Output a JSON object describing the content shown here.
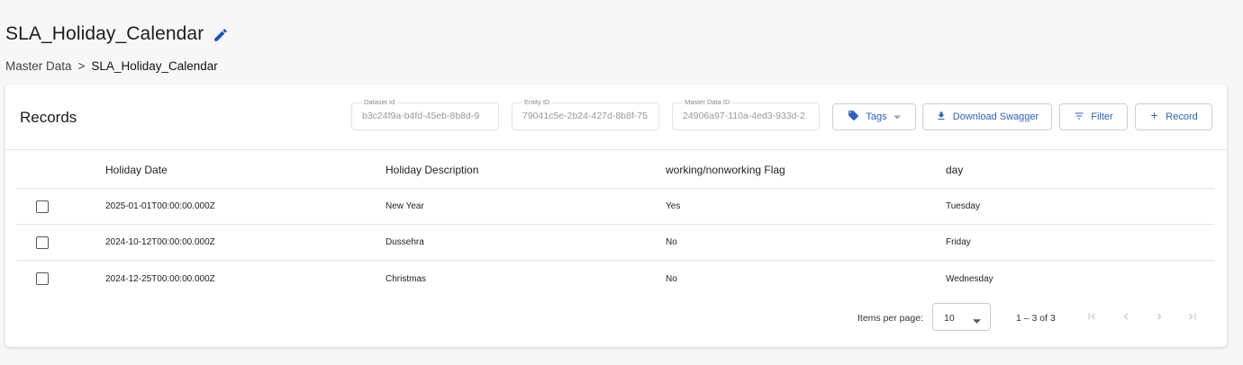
{
  "page": {
    "title": "SLA_Holiday_Calendar",
    "breadcrumb": {
      "parent": "Master Data",
      "separator": ">",
      "current": "SLA_Holiday_Calendar"
    }
  },
  "card": {
    "title": "Records",
    "fields": {
      "dataset": {
        "label": "Dataset Id",
        "value": "b3c24f9a-b4fd-45eb-8b8d-9"
      },
      "entity": {
        "label": "Entity ID",
        "value": "79041c5e-2b24-427d-8b8f-75"
      },
      "master": {
        "label": "Master Data ID",
        "value": "24906a97-110a-4ed3-933d-2"
      }
    },
    "buttons": {
      "tags": "Tags",
      "download": "Download Swagger",
      "filter": "Filter",
      "record": "Record"
    }
  },
  "table": {
    "headers": [
      "Holiday Date",
      "Holiday Description",
      "working/nonworking Flag",
      "day"
    ],
    "rows": [
      [
        "2025-01-01T00:00:00.000Z",
        "New Year",
        "Yes",
        "Tuesday"
      ],
      [
        "2024-10-12T00:00:00.000Z",
        "Dussehra",
        "No",
        "Friday"
      ],
      [
        "2024-12-25T00:00:00.000Z",
        "Christmas",
        "No",
        "Wednesday"
      ]
    ]
  },
  "paginator": {
    "items_per_page_label": "Items per page:",
    "items_per_page": "10",
    "range": "1 – 3 of 3"
  },
  "colors": {
    "accent": "#2f5fbf",
    "edit_icon": "#1e4fc2"
  },
  "icons": {
    "edit": "pencil-icon",
    "tags": "tag-icon",
    "download": "download-icon",
    "filter": "filter-icon",
    "record": "plus-icon"
  }
}
